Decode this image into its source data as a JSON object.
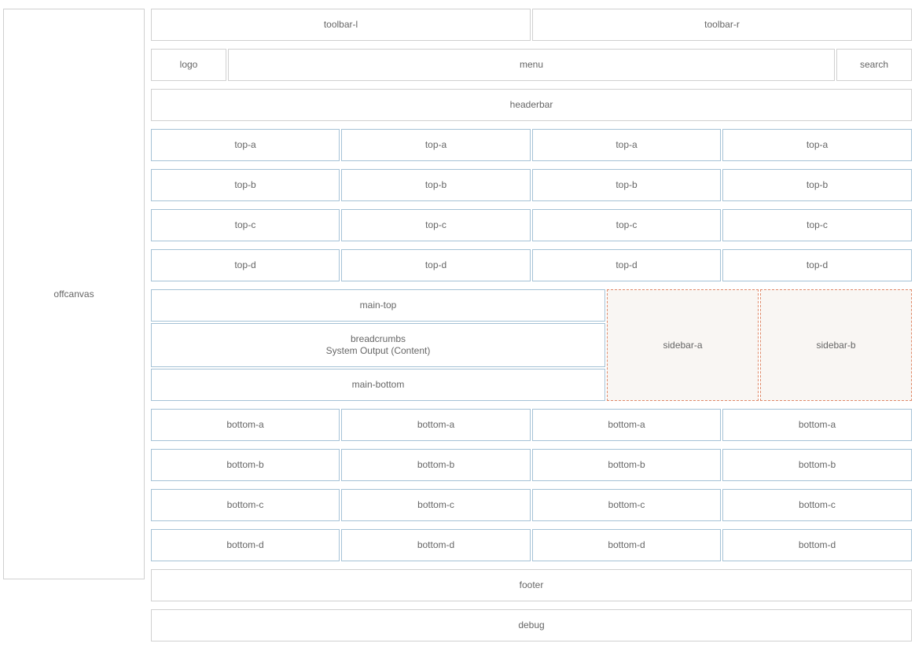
{
  "offcanvas": "offcanvas",
  "toolbar": {
    "left": "toolbar-l",
    "right": "toolbar-r"
  },
  "nav": {
    "logo": "logo",
    "menu": "menu",
    "search": "search"
  },
  "headerbar": "headerbar",
  "top_rows": [
    [
      "top-a",
      "top-a",
      "top-a",
      "top-a"
    ],
    [
      "top-b",
      "top-b",
      "top-b",
      "top-b"
    ],
    [
      "top-c",
      "top-c",
      "top-c",
      "top-c"
    ],
    [
      "top-d",
      "top-d",
      "top-d",
      "top-d"
    ]
  ],
  "main": {
    "top": "main-top",
    "breadcrumbs": "breadcrumbs",
    "content": "System Output (Content)",
    "bottom": "main-bottom"
  },
  "sidebar": {
    "a": "sidebar-a",
    "b": "sidebar-b"
  },
  "bottom_rows": [
    [
      "bottom-a",
      "bottom-a",
      "bottom-a",
      "bottom-a"
    ],
    [
      "bottom-b",
      "bottom-b",
      "bottom-b",
      "bottom-b"
    ],
    [
      "bottom-c",
      "bottom-c",
      "bottom-c",
      "bottom-c"
    ],
    [
      "bottom-d",
      "bottom-d",
      "bottom-d",
      "bottom-d"
    ]
  ],
  "footer": "footer",
  "debug": "debug"
}
